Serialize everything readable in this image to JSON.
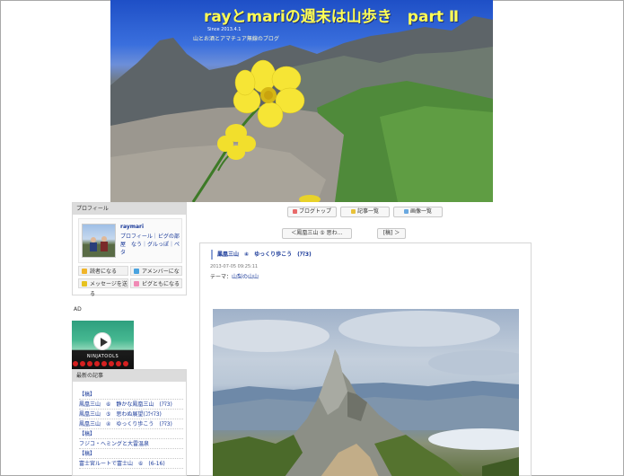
{
  "banner": {
    "title": "rayとmariの週末は山歩き　part Ⅱ",
    "since": "Since 2013.4.1",
    "subtitle": "山とお酒とアマチュア無線のブログ"
  },
  "profile": {
    "header": "プロフィール",
    "name": "raymari",
    "links": "プロフィール｜ピグの部屋　なう｜グルっぽ｜ペタ",
    "buttons": {
      "reader": "読者になる",
      "amember": "アメンバーになる",
      "message": "メッセージを送る",
      "pig": "ピグともになる"
    }
  },
  "ad": {
    "label": "AD",
    "ninja_text": "NINJATOOLS"
  },
  "recent": {
    "header": "最新の記事",
    "items": [
      "【稿】",
      "鳳凰三山　⑥　静かな鳳凰三山　(ｱﾏ3)",
      "鳳凰三山　⑤　思わぬ展望(ｺﾗｲﾏ3)",
      "鳳凰三山　④　ゆっくり歩こう　(ｱﾏ3)",
      "【稿】",
      "フジコ・ヘミングと大雷温泉",
      "【稿】",
      "富士宮ルートで富士山　⑥　(6-16)"
    ]
  },
  "nav": {
    "blog_top": "ブログトップ",
    "entry_list": "記事一覧",
    "image_list": "画像一覧",
    "prev": "＜鳳凰三山 ⑤ 思わ…",
    "next": "[稿] ＞"
  },
  "article": {
    "title": "鳳凰三山　④　ゆっくり歩こう　(ｱﾏ3)",
    "date": "2013-07-05 09:25:11",
    "theme_label": "テーマ：",
    "theme": "山梨の山山"
  },
  "colors": {
    "link": "#1a3a99",
    "banner_title": "#ffff55",
    "ninja_dot": "#d52020"
  }
}
